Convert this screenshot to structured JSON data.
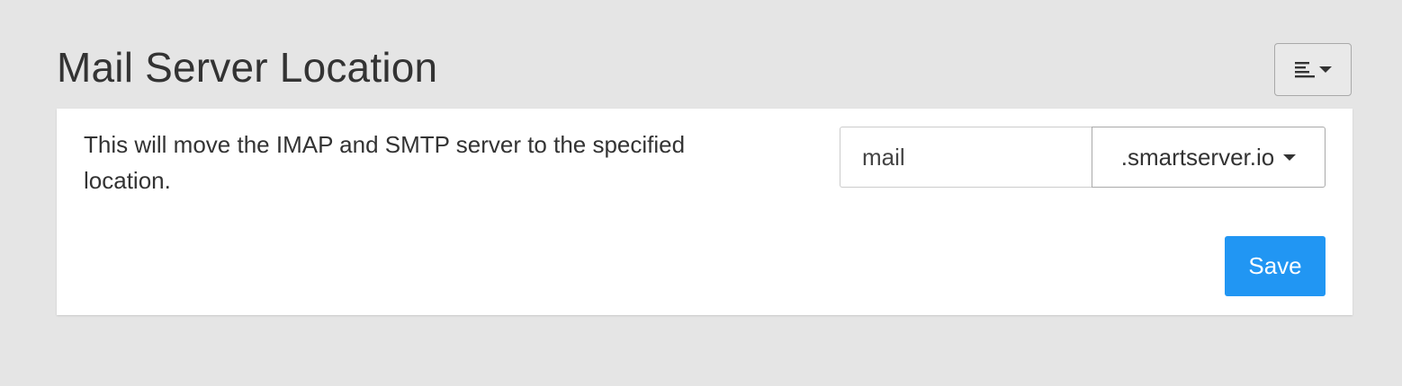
{
  "header": {
    "title": "Mail Server Location"
  },
  "menu": {
    "icon": "align-left-icon",
    "caret_icon": "caret-down-icon"
  },
  "panel": {
    "description": "This will move the IMAP and SMTP server to the specified location.",
    "subdomain_input": {
      "value": "mail",
      "placeholder": ""
    },
    "domain_select": {
      "selected": ".smartserver.io",
      "icon": "caret-down-icon"
    },
    "save_label": "Save"
  },
  "colors": {
    "background": "#e5e5e5",
    "panel": "#ffffff",
    "primary_button": "#2196f3",
    "text": "#333333"
  }
}
